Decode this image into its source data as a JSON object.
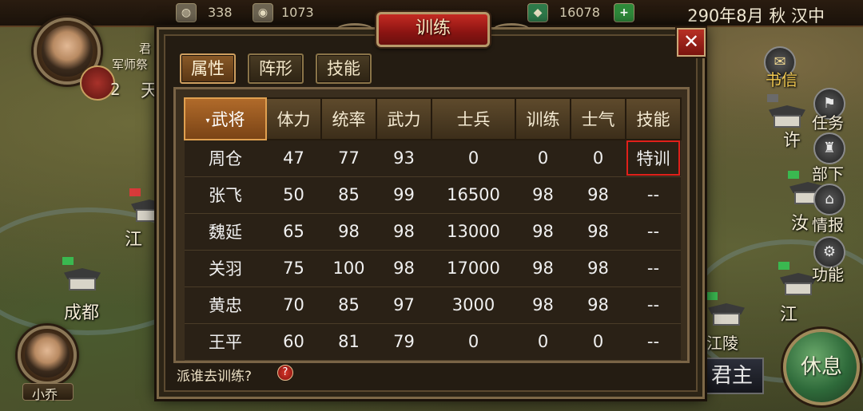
{
  "topbar": {
    "resources": [
      {
        "icon": "food-sack-icon",
        "value": "338"
      },
      {
        "icon": "money-bag-icon",
        "value": "1073"
      },
      {
        "icon": "gem-icon",
        "value": "16078"
      }
    ],
    "add_symbol": "+",
    "date": "290年8月 秋 汉中"
  },
  "left": {
    "avatar_top_labels": [
      "君",
      "军师祭"
    ],
    "level": "2",
    "bottom_avatar_name": "小乔"
  },
  "map_labels": [
    "天",
    "江",
    "成都",
    "许",
    "汝",
    "江",
    "江陵"
  ],
  "right_menu": [
    {
      "label": "书信",
      "icon": "letter-icon"
    },
    {
      "label": "任务",
      "icon": "flag-icon"
    },
    {
      "label": "部下",
      "icon": "soldier-icon"
    },
    {
      "label": "情报",
      "icon": "castle-icon"
    },
    {
      "label": "功能",
      "icon": "gear-icon"
    }
  ],
  "rest_label": "休息",
  "lord_label": "君主",
  "dialog": {
    "title": "训练",
    "close_symbol": "✕",
    "tabs": [
      "属性",
      "阵形",
      "技能"
    ],
    "active_tab": 0,
    "columns": [
      "武将",
      "体力",
      "统率",
      "武力",
      "士兵",
      "训练",
      "士气",
      "技能"
    ],
    "sort_marker": "▾",
    "rows": [
      [
        "周仓",
        "47",
        "77",
        "93",
        "0",
        "0",
        "0",
        "特训"
      ],
      [
        "张飞",
        "50",
        "85",
        "99",
        "16500",
        "98",
        "98",
        "--"
      ],
      [
        "魏延",
        "65",
        "98",
        "98",
        "13000",
        "98",
        "98",
        "--"
      ],
      [
        "关羽",
        "75",
        "100",
        "98",
        "17000",
        "98",
        "98",
        "--"
      ],
      [
        "黄忠",
        "70",
        "85",
        "97",
        "3000",
        "98",
        "98",
        "--"
      ],
      [
        "王平",
        "60",
        "81",
        "79",
        "0",
        "0",
        "0",
        "--"
      ]
    ],
    "prompt": "派谁去训练?",
    "help_symbol": "?"
  },
  "colors": {
    "accent_red": "#c42a22",
    "highlight_border": "#e0201a",
    "header_active": "#b06a2a",
    "tab_active": "#8a5a28"
  }
}
